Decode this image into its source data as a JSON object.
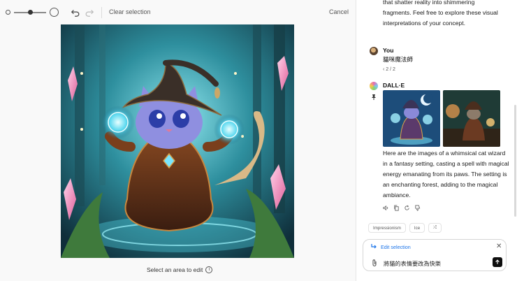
{
  "toolbar": {
    "brush_small_icon": "circle-outline-small",
    "brush_slider_icon": "slider",
    "brush_large_icon": "circle-outline-large",
    "undo_icon": "undo-arrow",
    "redo_icon": "redo-arrow",
    "clear_selection_label": "Clear selection",
    "cancel_label": "Cancel"
  },
  "editor": {
    "hint": "Select an area to edit",
    "hint_icon": "info-circle"
  },
  "chat": {
    "previous_message_lines": [
      "that shatter reality into shimmering",
      "fragments. Feel free to explore these visual",
      "interpretations of your concept."
    ],
    "user": {
      "name": "You",
      "message": "貓咪魔法師",
      "pager": "‹ 2 / 2"
    },
    "assistant": {
      "name": "DALL·E",
      "pin_icon": "pin",
      "response": "Here are the images of a whimsical cat wizard in a fantasy setting, casting a spell with magical energy emanating from its paws. The setting is an enchanting forest, adding to the magical ambiance."
    },
    "action_icons": [
      "speaker-icon",
      "copy-icon",
      "regenerate-icon",
      "thumbs-down-icon"
    ],
    "style_chips": [
      "Impressionism",
      "Ice",
      "⤮"
    ]
  },
  "composer": {
    "edit_selection_label": "Edit selection",
    "close_label": "✕",
    "prompt_text": "將貓的表情要改為快樂",
    "attach_icon": "paperclip",
    "send_icon": "arrow-up"
  },
  "colors": {
    "accent": "#1a73e8",
    "send_button": "#0d0d0d"
  }
}
